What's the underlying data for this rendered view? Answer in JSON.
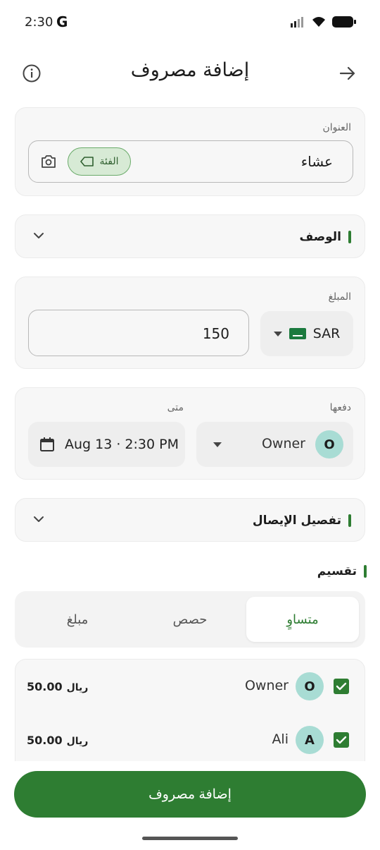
{
  "status_bar": {
    "time": "2:30",
    "carrier_logo": "G"
  },
  "app_bar": {
    "title": "إضافة مصروف",
    "back_icon": "arrow-right-icon",
    "info_icon": "info-icon"
  },
  "title_field": {
    "label": "العنوان",
    "value": "عشاء",
    "category_chip": "الفئة"
  },
  "description": {
    "label": "الوصف"
  },
  "amount": {
    "label": "المبلغ",
    "value": "150",
    "currency": "SAR"
  },
  "payment": {
    "paid_by_label": "دفعها",
    "when_label": "متى",
    "payer_initial": "O",
    "payer_name": "Owner",
    "date": "Aug 13 · 2:30 PM"
  },
  "receipt": {
    "label": "تفصيل الإيصال"
  },
  "split": {
    "label": "تقسيم",
    "tabs": [
      "متساوٍ",
      "حصص",
      "مبلغ"
    ],
    "active_tab": 0,
    "members": [
      {
        "initial": "O",
        "name": "Owner",
        "amount": "50.00",
        "currency": "ريال",
        "checked": true
      },
      {
        "initial": "A",
        "name": "Ali",
        "amount": "50.00",
        "currency": "ريال",
        "checked": true
      }
    ]
  },
  "submit": {
    "label": "إضافة مصروف"
  },
  "colors": {
    "accent": "#2e7d32",
    "avatar": "#a8dcd4",
    "chip": "#d7ead5"
  }
}
